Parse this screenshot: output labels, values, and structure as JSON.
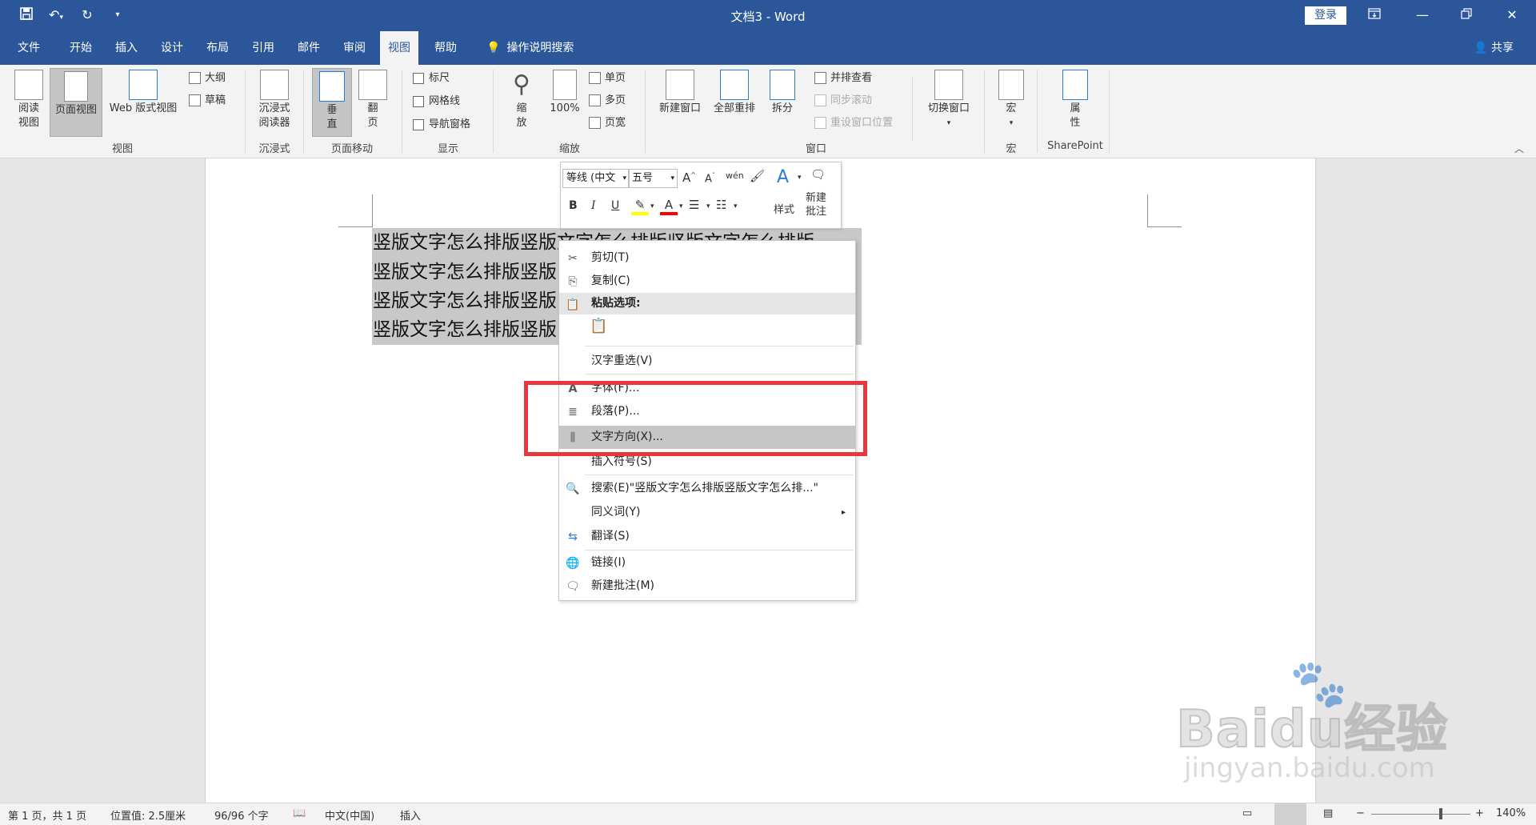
{
  "window": {
    "title": "文档3  -  Word",
    "login_label": "登录",
    "controls": [
      "ribbon-display-icon",
      "minimize-icon",
      "restore-icon",
      "close-icon"
    ]
  },
  "qat": [
    "save-icon",
    "undo-icon",
    "redo-icon",
    "customize-icon"
  ],
  "tabs": [
    {
      "label": "文件"
    },
    {
      "label": "开始"
    },
    {
      "label": "插入"
    },
    {
      "label": "设计"
    },
    {
      "label": "布局"
    },
    {
      "label": "引用"
    },
    {
      "label": "邮件"
    },
    {
      "label": "审阅"
    },
    {
      "label": "视图",
      "active": true
    },
    {
      "label": "帮助"
    }
  ],
  "tell_me": "操作说明搜索",
  "share_label": "共享",
  "ribbon": {
    "views": {
      "read_mode": "阅读\n视图",
      "print_layout": "页面视图",
      "web_layout": "Web 版式视图",
      "outline": "大纲",
      "draft": "草稿",
      "group": "视图"
    },
    "immersive": {
      "reader": "沉浸式\n阅读器",
      "group": "沉浸式"
    },
    "page_movement": {
      "vertical": "垂\n直",
      "side": "翻\n页",
      "group": "页面移动"
    },
    "show": {
      "ruler": "标尺",
      "gridlines": "网格线",
      "nav_pane": "导航窗格",
      "group": "显示"
    },
    "zoom": {
      "zoom": "缩\n放",
      "hundred": "100%",
      "one_page": "单页",
      "multi_page": "多页",
      "page_width": "页宽",
      "group": "缩放"
    },
    "window": {
      "new_window": "新建窗口",
      "arrange_all": "全部重排",
      "split": "拆分",
      "side_by_side": "并排查看",
      "sync_scroll": "同步滚动",
      "reset_pos": "重设窗口位置",
      "switch": "切换窗口",
      "group": "窗口"
    },
    "macros": {
      "macros": "宏",
      "group": "宏"
    },
    "sharepoint": {
      "props": "属\n性",
      "group": "SharePoint"
    }
  },
  "document": {
    "lines": [
      "竖版文字怎么排版竖版文字怎么排版竖版文字怎么排版",
      "竖版文字怎么排版竖版",
      "竖版文字怎么排版竖版",
      "竖版文字怎么排版竖版"
    ]
  },
  "mini_toolbar": {
    "font": "等线 (中文",
    "size": "五号",
    "bold": "B",
    "italic": "I",
    "underline": "U",
    "styles": "样式",
    "new_comment": "新建\n批注",
    "highlight_color": "#ffff00",
    "font_color": "#ff0000"
  },
  "context_menu": {
    "items": [
      {
        "label": "剪切(T)",
        "icon": "scissors-icon"
      },
      {
        "label": "复制(C)",
        "icon": "copy-icon"
      },
      {
        "label": "粘贴选项:",
        "icon": "paste-icon",
        "header": true
      },
      {
        "label": "汉字重选(V)",
        "icon": ""
      },
      {
        "label": "字体(F)...",
        "icon": "font-icon"
      },
      {
        "label": "段落(P)...",
        "icon": "paragraph-icon"
      },
      {
        "label": "文字方向(X)...",
        "icon": "text-direction-icon",
        "hover": true
      },
      {
        "label": "插入符号(S)",
        "icon": ""
      },
      {
        "label": "搜索(E)\"竖版文字怎么排版竖版文字怎么排...\"",
        "icon": "search-icon"
      },
      {
        "label": "同义词(Y)",
        "icon": "",
        "submenu": true
      },
      {
        "label": "翻译(S)",
        "icon": "translate-icon"
      },
      {
        "label": "链接(I)",
        "icon": "link-icon"
      },
      {
        "label": "新建批注(M)",
        "icon": "comment-icon"
      }
    ]
  },
  "highlight_color": "#e8373a",
  "status": {
    "page": "第 1 页，共 1 页",
    "position": "位置值: 2.5厘米",
    "words": "96/96 个字",
    "language": "中文(中国)",
    "mode": "插入",
    "zoom": "140%",
    "zoom_level": 0.7
  },
  "watermark": {
    "brand": "Baidu经验",
    "url": "jingyan.baidu.com"
  }
}
